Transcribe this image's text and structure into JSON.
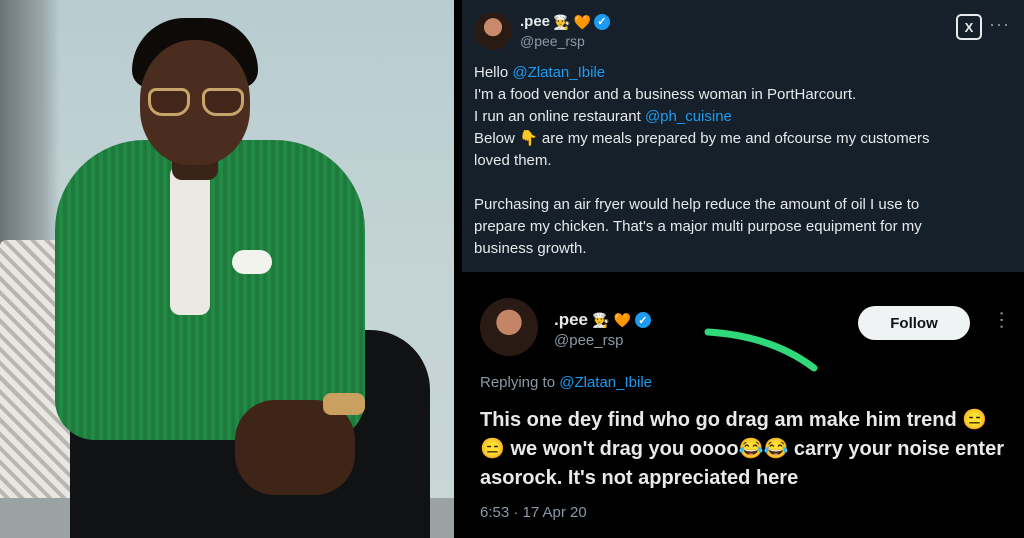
{
  "colors": {
    "top_bg": "#15202b",
    "bottom_bg": "#000000",
    "link": "#1d9bf0",
    "verified": "#1d9bf0",
    "highlight_stroke": "#2fd879"
  },
  "photo": {
    "description_icon": "person-photo"
  },
  "tweet_top": {
    "name": ".pee",
    "handle": "@pee_rsp",
    "name_emojis": [
      "👨‍🍳",
      "🧡"
    ],
    "x_button_label": "X",
    "more_label": "···",
    "lines": [
      {
        "text": "Hello ",
        "mention": "@Zlatan_Ibile",
        "after": ""
      },
      {
        "text": "I'm a food vendor and a business woman in PortHarcourt.",
        "mention": "",
        "after": ""
      },
      {
        "text": "I run an online restaurant ",
        "mention": "@ph_cuisine",
        "after": ""
      },
      {
        "text": "Below 👇 are my meals prepared by me and ofcourse my customers",
        "mention": "",
        "after": ""
      },
      {
        "text": "loved them.",
        "mention": "",
        "after": ""
      },
      {
        "text": "",
        "mention": "",
        "after": ""
      },
      {
        "text": "Purchasing an air fryer would help reduce the amount of oil I use to",
        "mention": "",
        "after": ""
      },
      {
        "text": "prepare my chicken. That's a major multi purpose equipment for my",
        "mention": "",
        "after": ""
      },
      {
        "text": "business growth.",
        "mention": "",
        "after": ""
      }
    ]
  },
  "tweet_bottom": {
    "name": ".pee",
    "handle": "@pee_rsp",
    "name_emojis": [
      "👨‍🍳",
      "🧡"
    ],
    "follow_label": "Follow",
    "more_label": "···",
    "replying_prefix": "Replying to ",
    "replying_mention": "@Zlatan_Ibile",
    "text": "This one dey find who go drag am make him trend 😑😑 we won't drag you oooo😂😂 carry your noise enter asorock. It's not appreciated here",
    "timestamp": "6:53 · 17 Apr 20"
  }
}
